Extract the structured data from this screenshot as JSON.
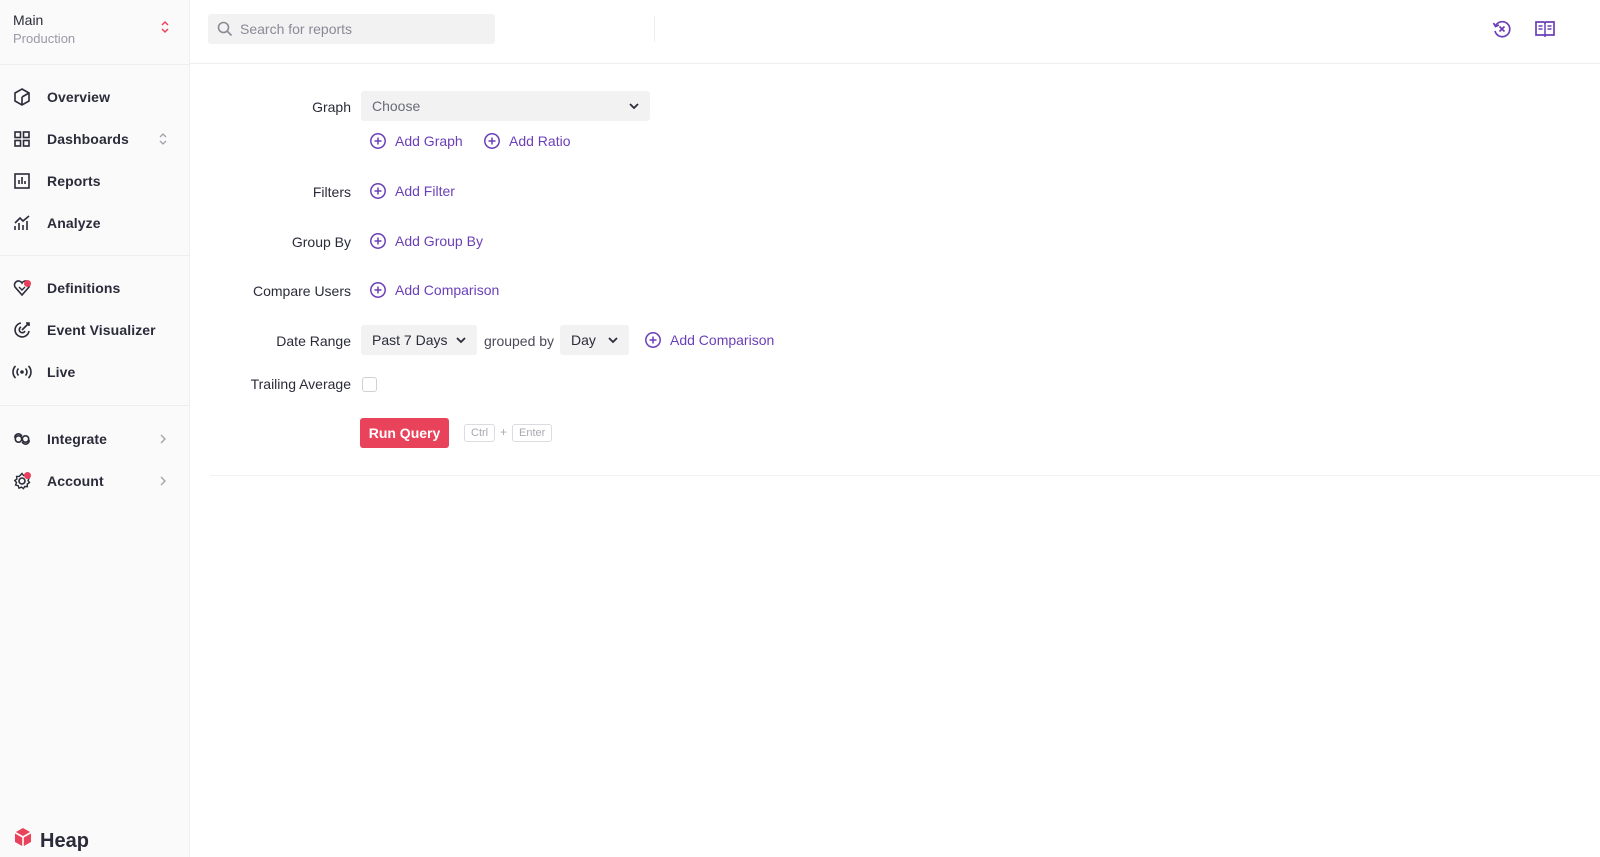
{
  "sidebar": {
    "env": {
      "main": "Main",
      "sub": "Production"
    },
    "items": [
      {
        "label": "Overview"
      },
      {
        "label": "Dashboards"
      },
      {
        "label": "Reports"
      },
      {
        "label": "Analyze"
      },
      {
        "label": "Definitions"
      },
      {
        "label": "Event Visualizer"
      },
      {
        "label": "Live"
      },
      {
        "label": "Integrate"
      },
      {
        "label": "Account"
      }
    ],
    "logo": "Heap"
  },
  "topbar": {
    "search_placeholder": "Search for reports"
  },
  "form": {
    "graph": {
      "label": "Graph",
      "select_value": "Choose",
      "add_graph": "Add Graph",
      "add_ratio": "Add Ratio"
    },
    "filters": {
      "label": "Filters",
      "add_filter": "Add Filter"
    },
    "group_by": {
      "label": "Group By",
      "add_group_by": "Add Group By"
    },
    "compare_users": {
      "label": "Compare Users",
      "add_comparison": "Add Comparison"
    },
    "date_range": {
      "label": "Date Range",
      "range_value": "Past 7 Days",
      "grouped_by": "grouped by",
      "group_value": "Day",
      "add_comparison": "Add Comparison"
    },
    "trailing_average": {
      "label": "Trailing Average"
    },
    "run": {
      "label": "Run Query",
      "shortcut_key1": "Ctrl",
      "shortcut_plus": "+",
      "shortcut_key2": "Enter"
    }
  },
  "colors": {
    "accent": "#6b3fb8",
    "primary_button": "#e8435a",
    "notification_dot": "#e83e5b",
    "text": "#2b2b3a"
  }
}
